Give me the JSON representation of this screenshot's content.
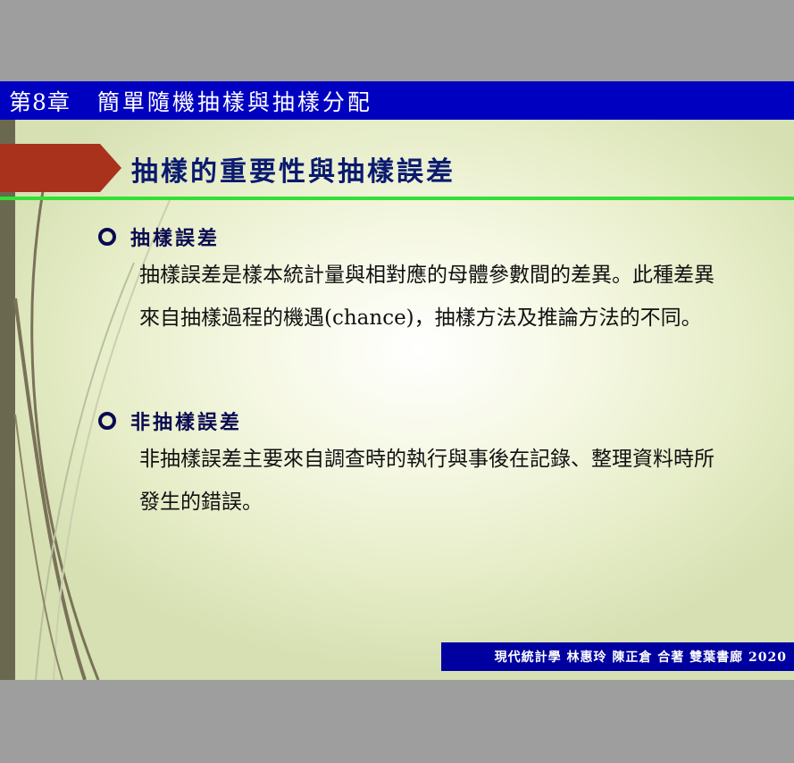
{
  "header": {
    "chapter": "第8章",
    "chapter_title": "簡單隨機抽樣與抽樣分配"
  },
  "section": {
    "title": "抽樣的重要性與抽樣誤差"
  },
  "items": [
    {
      "heading": "抽樣誤差",
      "body": "抽樣誤差是樣本統計量與相對應的母體參數間的差異。此種差異來自抽樣過程的機遇(chance)，抽樣方法及推論方法的不同。"
    },
    {
      "heading": "非抽樣誤差",
      "body": "非抽樣誤差主要來自調查時的執行與事後在記錄、整理資料時所發生的錯誤。"
    }
  ],
  "footer": {
    "text": "現代統計學 林惠玲 陳正倉 合著 雙葉書廊 2020"
  },
  "colors": {
    "header_bg": "#0000c0",
    "title_text": "#0a1a6e",
    "arrow": "#a8321c",
    "divider": "#33e033",
    "footer_bg": "#0000a0"
  }
}
